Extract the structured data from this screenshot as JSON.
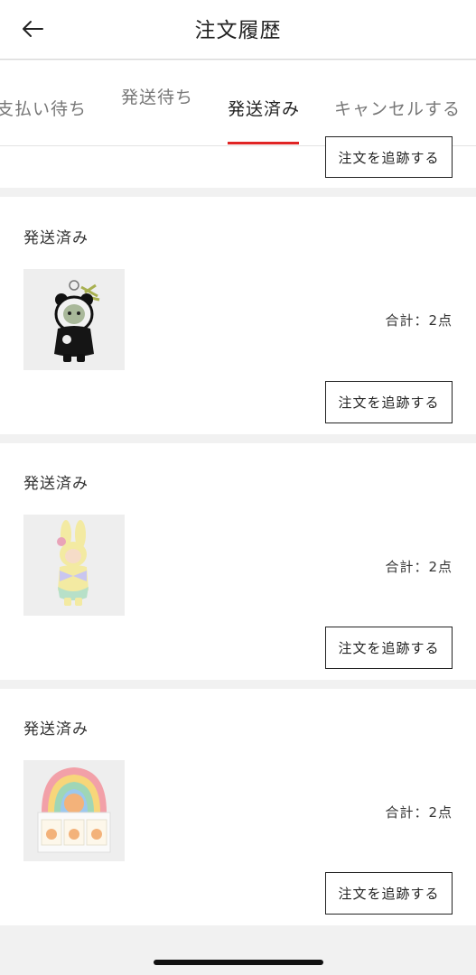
{
  "header": {
    "title": "注文履歴",
    "back_icon": "arrow-left-icon"
  },
  "tabs": [
    {
      "label": "支払い待ち",
      "active": false
    },
    {
      "label": "発送待ち",
      "active": false
    },
    {
      "label": "発送済み",
      "active": true
    },
    {
      "label": "キャンセルする",
      "active": false
    }
  ],
  "partial_card": {
    "track_label": "注文を追跡する"
  },
  "orders": [
    {
      "status": "発送済み",
      "total": "合計：2点",
      "track_label": "注文を追跡する",
      "thumb": "panda-doll-keychain-image"
    },
    {
      "status": "発送済み",
      "total": "合計：2点",
      "track_label": "注文を追跡する",
      "thumb": "bunny-doll-image"
    },
    {
      "status": "発送済み",
      "total": "合計：2点",
      "track_label": "注文を追跡する",
      "thumb": "blind-box-set-image"
    }
  ],
  "colors": {
    "accent": "#e02424",
    "background": "#f1f1f1"
  }
}
